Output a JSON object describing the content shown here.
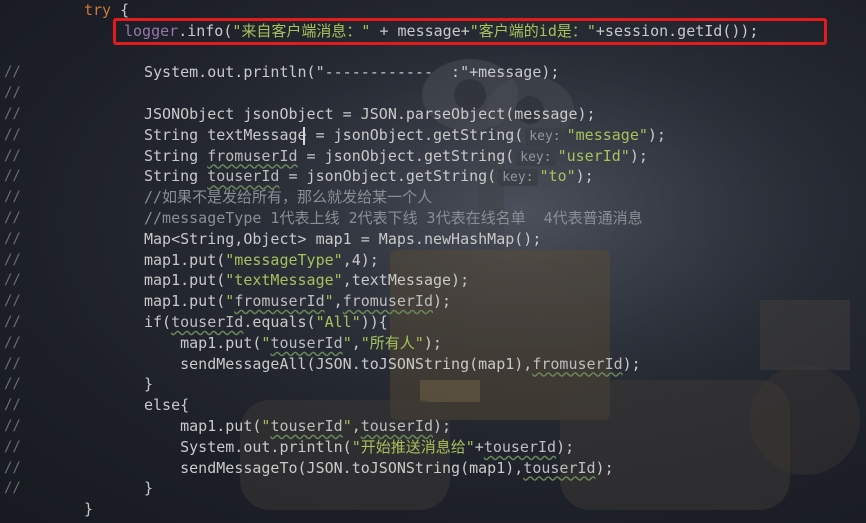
{
  "code_lines": [
    {
      "gutter": "",
      "parts": [
        {
          "t": "kw",
          "v": "try"
        },
        {
          "t": "plain",
          "v": " {"
        }
      ]
    },
    {
      "gutter": "",
      "parts": [
        {
          "t": "fld",
          "v": "logger"
        },
        {
          "t": "plain",
          "v": ".info("
        },
        {
          "t": "str",
          "v": "\"来自客户端消息：\""
        },
        {
          "t": "plain",
          "v": " + message+"
        },
        {
          "t": "str",
          "v": "\"客户端的id是：\""
        },
        {
          "t": "plain",
          "v": "+session.getId());"
        }
      ]
    },
    {
      "gutter": "",
      "parts": []
    },
    {
      "gutter": "//",
      "parts": [
        {
          "t": "plain",
          "v": "System.out.println(\"------------  :\"+message);"
        }
      ]
    },
    {
      "gutter": "//",
      "parts": []
    },
    {
      "gutter": "//",
      "parts": [
        {
          "t": "plain",
          "v": "JSONObject jsonObject = JSON.parseObject(message);"
        }
      ]
    },
    {
      "gutter": "//",
      "parts": [
        {
          "t": "plain",
          "v": "String textMessage = jsonObject.getString("
        },
        {
          "t": "hint",
          "v": "key:"
        },
        {
          "t": "str",
          "v": "\"message\""
        },
        {
          "t": "plain",
          "v": ");"
        }
      ]
    },
    {
      "gutter": "//",
      "parts": [
        {
          "t": "plain",
          "v": "String "
        },
        {
          "t": "var",
          "v": "fromuserId"
        },
        {
          "t": "plain",
          "v": " = jsonObject.getString("
        },
        {
          "t": "hint",
          "v": "key:"
        },
        {
          "t": "str",
          "v": "\"userId\""
        },
        {
          "t": "plain",
          "v": ");"
        }
      ]
    },
    {
      "gutter": "//",
      "parts": [
        {
          "t": "plain",
          "v": "String "
        },
        {
          "t": "var",
          "v": "touserId"
        },
        {
          "t": "plain",
          "v": " = jsonObject.getString("
        },
        {
          "t": "hint",
          "v": "key:"
        },
        {
          "t": "str",
          "v": "\"to\""
        },
        {
          "t": "plain",
          "v": ");"
        }
      ]
    },
    {
      "gutter": "//",
      "parts": [
        {
          "t": "cmt",
          "v": "//如果不是发给所有，那么就发给某一个人"
        }
      ]
    },
    {
      "gutter": "//",
      "parts": [
        {
          "t": "cmt",
          "v": "//messageType 1代表上线 2代表下线 3代表在线名单  4代表普通消息"
        }
      ]
    },
    {
      "gutter": "//",
      "parts": [
        {
          "t": "plain",
          "v": "Map<String,Object> map1 = Maps.newHashMap();"
        }
      ]
    },
    {
      "gutter": "//",
      "parts": [
        {
          "t": "plain",
          "v": "map1.put("
        },
        {
          "t": "str",
          "v": "\"messageType\""
        },
        {
          "t": "plain",
          "v": ",4);"
        }
      ]
    },
    {
      "gutter": "//",
      "parts": [
        {
          "t": "plain",
          "v": "map1.put("
        },
        {
          "t": "str",
          "v": "\"textMessage\""
        },
        {
          "t": "plain",
          "v": ",textMessage);"
        }
      ]
    },
    {
      "gutter": "//",
      "parts": [
        {
          "t": "plain",
          "v": "map1.put("
        },
        {
          "t": "str",
          "v": "\""
        },
        {
          "t": "var",
          "v": "fromuserId"
        },
        {
          "t": "str",
          "v": "\""
        },
        {
          "t": "plain",
          "v": ","
        },
        {
          "t": "var",
          "v": "fromuserId"
        },
        {
          "t": "plain",
          "v": ");"
        }
      ]
    },
    {
      "gutter": "//",
      "parts": [
        {
          "t": "plain",
          "v": "if("
        },
        {
          "t": "var",
          "v": "touserId"
        },
        {
          "t": "plain",
          "v": ".equals("
        },
        {
          "t": "str",
          "v": "\"All\""
        },
        {
          "t": "plain",
          "v": ")){"
        }
      ]
    },
    {
      "gutter": "//",
      "parts": [
        {
          "t": "plain",
          "v": "    map1.put("
        },
        {
          "t": "str",
          "v": "\""
        },
        {
          "t": "var",
          "v": "touserId"
        },
        {
          "t": "str",
          "v": "\""
        },
        {
          "t": "plain",
          "v": ","
        },
        {
          "t": "str",
          "v": "\"所有人\""
        },
        {
          "t": "plain",
          "v": ");"
        }
      ]
    },
    {
      "gutter": "//",
      "parts": [
        {
          "t": "plain",
          "v": "    sendMessageAll(JSON.toJSONString(map1),"
        },
        {
          "t": "var",
          "v": "fromuserId"
        },
        {
          "t": "plain",
          "v": ");"
        }
      ]
    },
    {
      "gutter": "//",
      "parts": [
        {
          "t": "plain",
          "v": "}"
        }
      ]
    },
    {
      "gutter": "//",
      "parts": [
        {
          "t": "plain",
          "v": "else{"
        }
      ]
    },
    {
      "gutter": "//",
      "parts": [
        {
          "t": "plain",
          "v": "    map1.put("
        },
        {
          "t": "str",
          "v": "\""
        },
        {
          "t": "var",
          "v": "touserId"
        },
        {
          "t": "str",
          "v": "\""
        },
        {
          "t": "plain",
          "v": ","
        },
        {
          "t": "var",
          "v": "touserId"
        },
        {
          "t": "plain",
          "v": ");"
        }
      ]
    },
    {
      "gutter": "//",
      "parts": [
        {
          "t": "plain",
          "v": "    System.out.println("
        },
        {
          "t": "str",
          "v": "\"开始推送消息给\""
        },
        {
          "t": "plain",
          "v": "+"
        },
        {
          "t": "var",
          "v": "touserId"
        },
        {
          "t": "plain",
          "v": ");"
        }
      ]
    },
    {
      "gutter": "//",
      "parts": [
        {
          "t": "plain",
          "v": "    sendMessageTo(JSON.toJSONString(map1),"
        },
        {
          "t": "var",
          "v": "touserId"
        },
        {
          "t": "plain",
          "v": ");"
        }
      ]
    },
    {
      "gutter": "//",
      "parts": [
        {
          "t": "plain",
          "v": "}"
        }
      ]
    },
    {
      "gutter": "",
      "parts": [
        {
          "t": "plain",
          "v": "}"
        }
      ]
    }
  ],
  "colors": {
    "keyword": "#cc7832",
    "string": "#a5c25c",
    "comment": "#8a8f96",
    "highlight_border": "#e31b1b"
  }
}
